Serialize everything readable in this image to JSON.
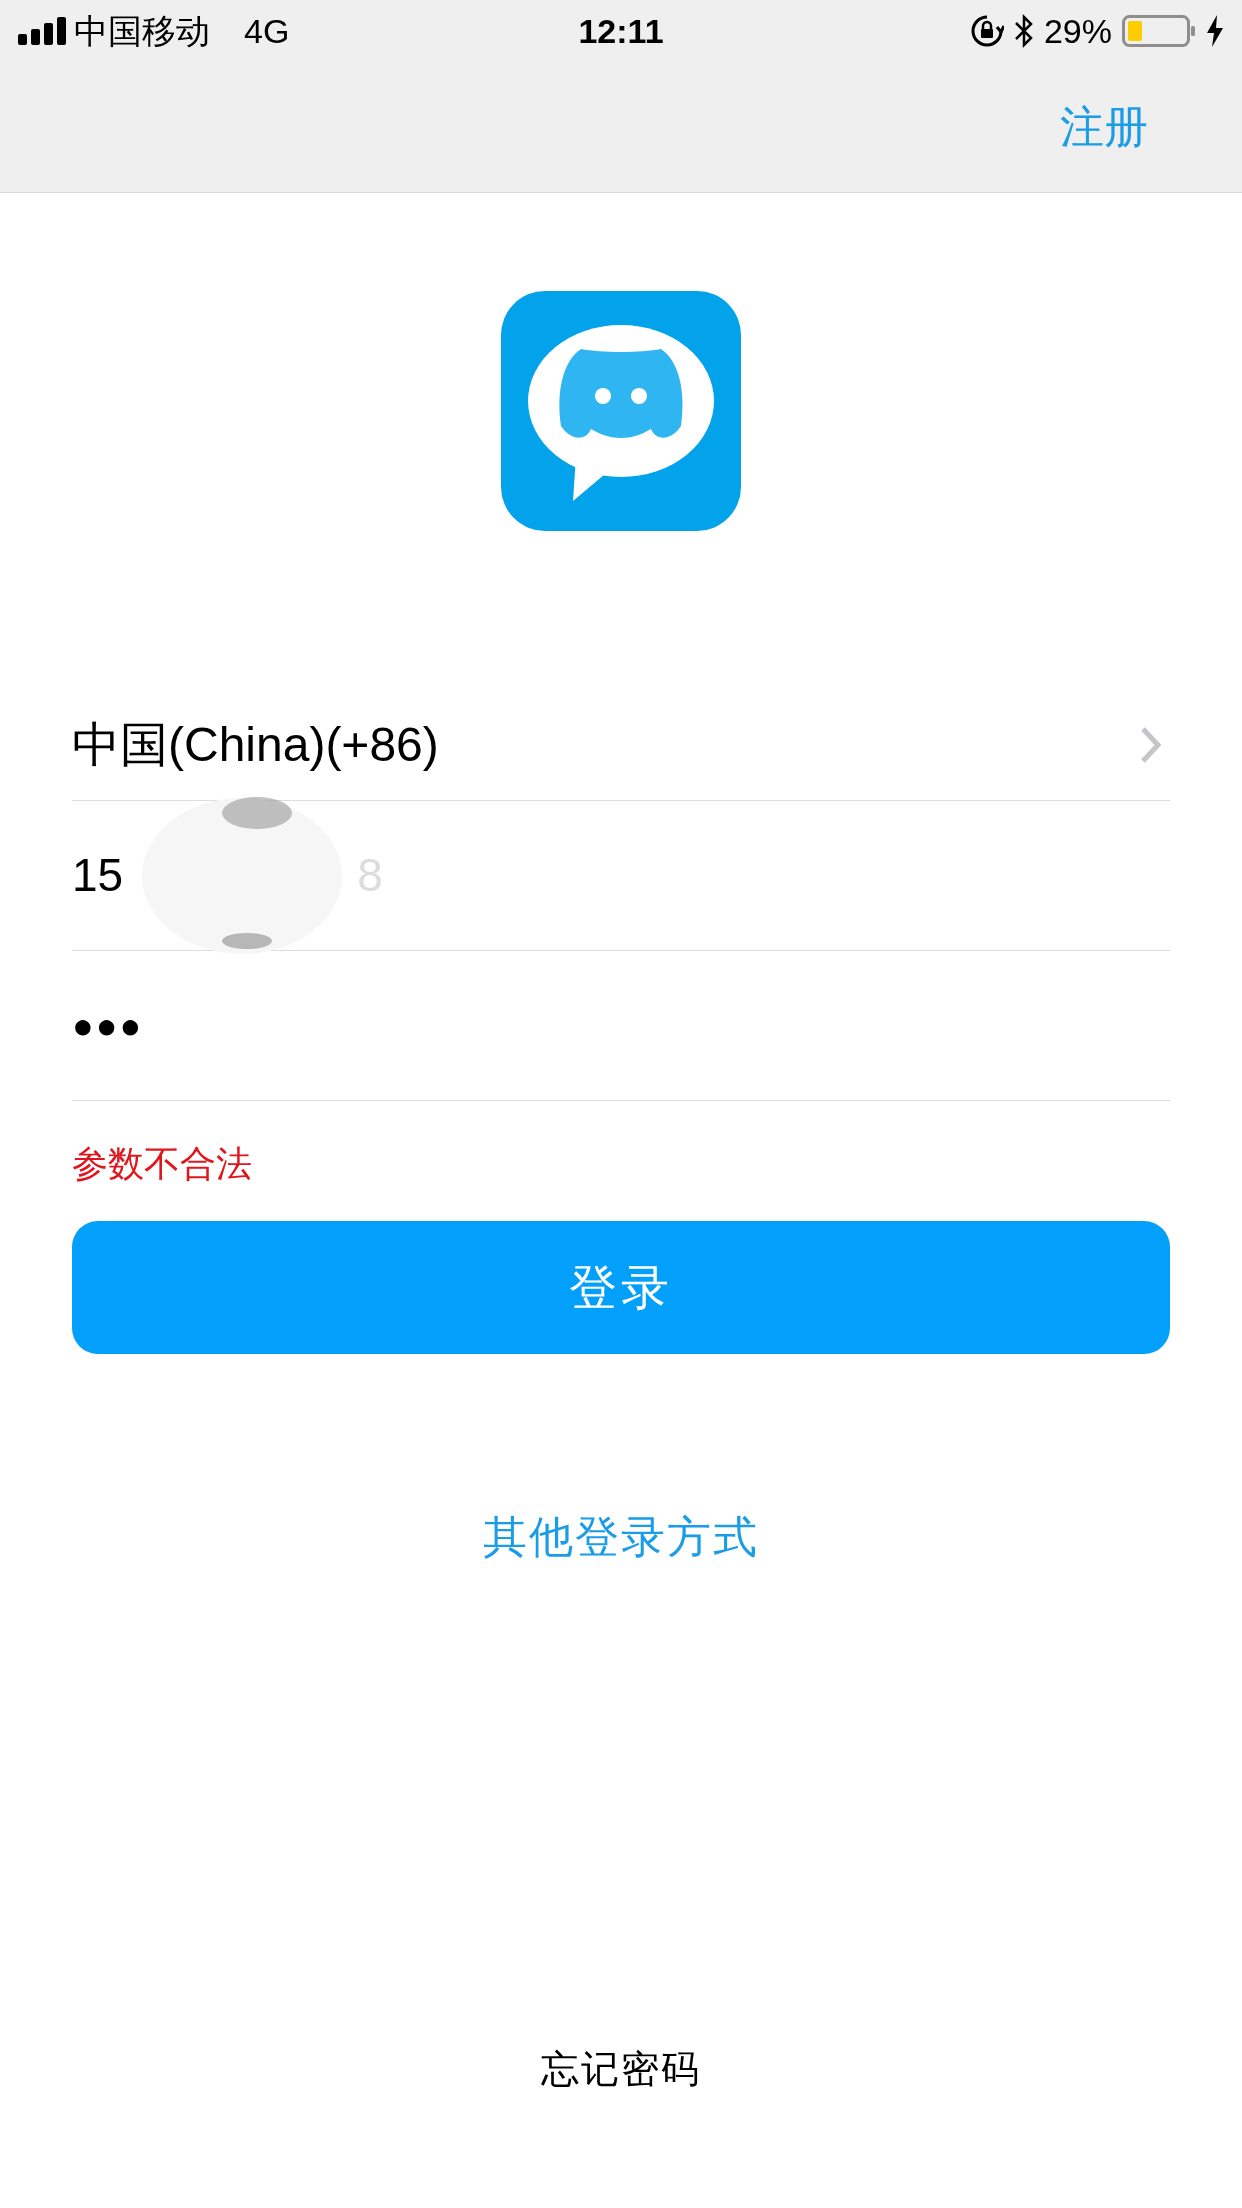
{
  "status_bar": {
    "carrier": "中国移动",
    "network": "4G",
    "time": "12:11",
    "battery": "29%"
  },
  "nav_bar": {
    "action": "注册"
  },
  "country_row": {
    "label": "中国(China)(+86)"
  },
  "phone_field": {
    "value_start": "15",
    "value_end": "8"
  },
  "password_field": {
    "value": "●●●"
  },
  "error_message": "参数不合法",
  "login_button": "登录",
  "other_login_link": "其他登录方式",
  "forgot_password_link": "忘记密码"
}
